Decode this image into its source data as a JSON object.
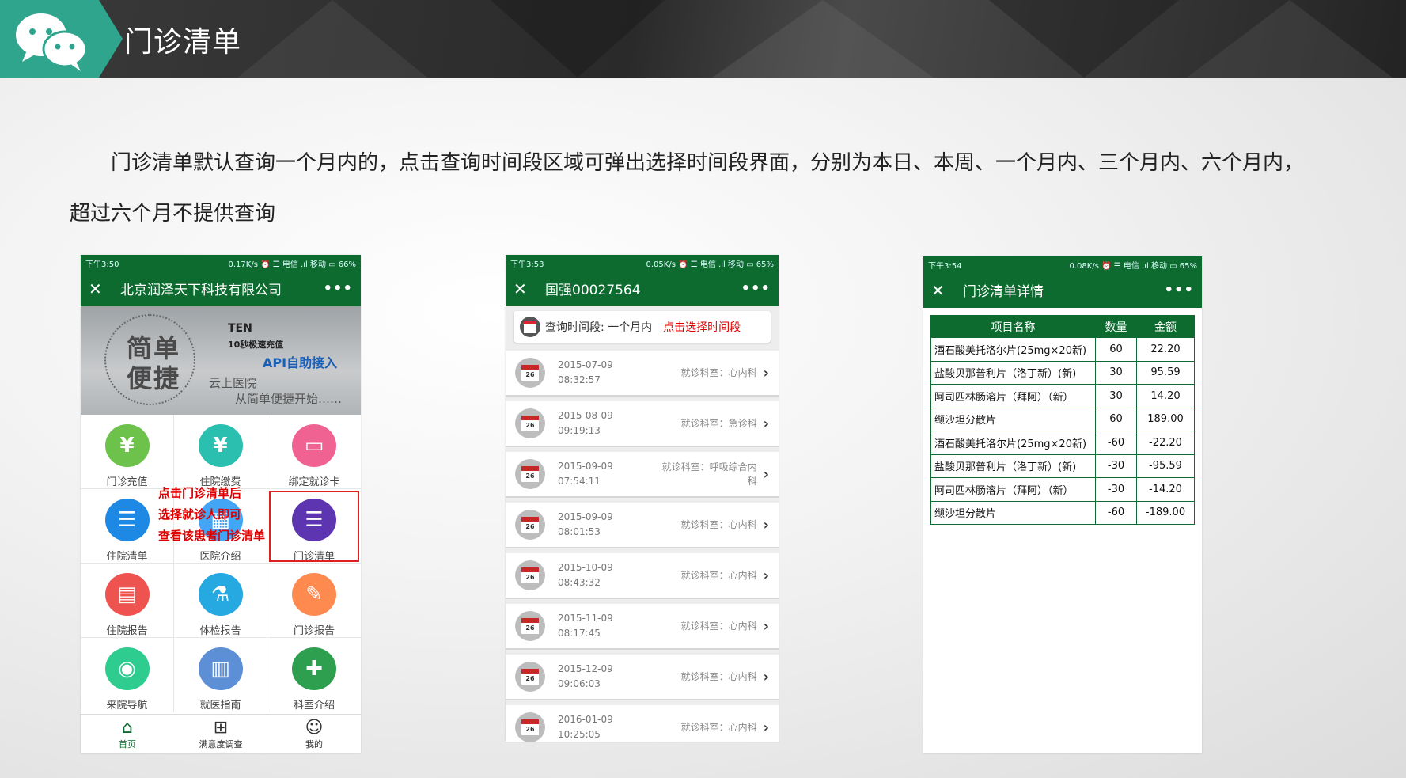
{
  "slide": {
    "title": "门诊清单",
    "intro_line1": "门诊清单默认查询一个月内的，点击查询时间段区域可弹出选择时间段界面，分别为本日、本周、一个月内、三个月内、六个月内，",
    "intro_line2": "超过六个月不提供查询",
    "logo_icon": "wechat-icon",
    "accent_color": "#2fa58d"
  },
  "phone1": {
    "status_time": "下午3:50",
    "status_info": "0.17K/s ⏰ ☰ 电信 .ıl 移动 ▭ 66%",
    "nav_title": "北京润泽天下科技有限公司",
    "banner": {
      "big1": "简单",
      "big2": "便捷",
      "ten": "TEN",
      "ten_sub": "10秒极速充值",
      "api": "API自助接入",
      "cloud": "云上医院",
      "slogan": "从简单便捷开始……"
    },
    "grid": [
      {
        "label": "门诊充值",
        "icon": "yen-icon",
        "color": "#6cc24a"
      },
      {
        "label": "住院缴费",
        "icon": "yen-icon",
        "color": "#2bbfb0"
      },
      {
        "label": "绑定就诊卡",
        "icon": "card-icon",
        "color": "#f06292"
      },
      {
        "label": "住院清单",
        "icon": "list-icon",
        "color": "#1e88e5"
      },
      {
        "label": "医院介绍",
        "icon": "hospital-icon",
        "color": "#42a5f5"
      },
      {
        "label": "门诊清单",
        "icon": "list-icon",
        "color": "#5e35b1"
      },
      {
        "label": "住院报告",
        "icon": "report-icon",
        "color": "#ef5350"
      },
      {
        "label": "体检报告",
        "icon": "microscope-icon",
        "color": "#26a9e0"
      },
      {
        "label": "门诊报告",
        "icon": "clipboard-icon",
        "color": "#ff8a50"
      },
      {
        "label": "来院导航",
        "icon": "location-icon",
        "color": "#2ecc8f"
      },
      {
        "label": "就医指南",
        "icon": "building-icon",
        "color": "#5c8fd6"
      },
      {
        "label": "科室介绍",
        "icon": "bed-icon",
        "color": "#2e9e4f"
      }
    ],
    "annotation": [
      "点击门诊清单后",
      "选择就诊人即可",
      "查看该患者门诊清单"
    ],
    "tabs": [
      {
        "label": "首页",
        "icon": "home-icon"
      },
      {
        "label": "满意度调查",
        "icon": "grid-icon"
      },
      {
        "label": "我的",
        "icon": "person-icon"
      }
    ]
  },
  "phone2": {
    "status_time": "下午3:53",
    "status_info": "0.05K/s ⏰ ☰ 电信 .ıl 移动 ▭ 65%",
    "nav_title": "国强00027564",
    "query_label": "查询时间段: 一个月内",
    "query_link": "点击选择时间段",
    "visits": [
      {
        "date": "2015-07-09",
        "time": "08:32:57",
        "dept": "就诊科室：心内科",
        "day": "26"
      },
      {
        "date": "2015-08-09",
        "time": "09:19:13",
        "dept": "就诊科室：急诊科",
        "day": "26"
      },
      {
        "date": "2015-09-09",
        "time": "07:54:11",
        "dept": "就诊科室：呼吸综合内科",
        "day": "26"
      },
      {
        "date": "2015-09-09",
        "time": "08:01:53",
        "dept": "就诊科室：心内科",
        "day": "26"
      },
      {
        "date": "2015-10-09",
        "time": "08:43:32",
        "dept": "就诊科室：心内科",
        "day": "26"
      },
      {
        "date": "2015-11-09",
        "time": "08:17:45",
        "dept": "就诊科室：心内科",
        "day": "26"
      },
      {
        "date": "2015-12-09",
        "time": "09:06:03",
        "dept": "就诊科室：心内科",
        "day": "26"
      },
      {
        "date": "2016-01-09",
        "time": "10:25:05",
        "dept": "就诊科室：心内科",
        "day": "26"
      }
    ]
  },
  "phone3": {
    "status_time": "下午3:54",
    "status_info": "0.08K/s ⏰ ☰ 电信 .ıl 移动 ▭ 65%",
    "nav_title": "门诊清单详情",
    "columns": [
      "项目名称",
      "数量",
      "金额"
    ],
    "rows": [
      [
        "酒石酸美托洛尔片(25mg×20新)",
        "60",
        "22.20"
      ],
      [
        "盐酸贝那普利片（洛丁新）(新)",
        "30",
        "95.59"
      ],
      [
        "阿司匹林肠溶片（拜阿）（新）",
        "30",
        "14.20"
      ],
      [
        "缬沙坦分散片",
        "60",
        "189.00"
      ],
      [
        "酒石酸美托洛尔片(25mg×20新)",
        "-60",
        "-22.20"
      ],
      [
        "盐酸贝那普利片（洛丁新）(新)",
        "-30",
        "-95.59"
      ],
      [
        "阿司匹林肠溶片（拜阿）（新）",
        "-30",
        "-14.20"
      ],
      [
        "缬沙坦分散片",
        "-60",
        "-189.00"
      ]
    ]
  }
}
